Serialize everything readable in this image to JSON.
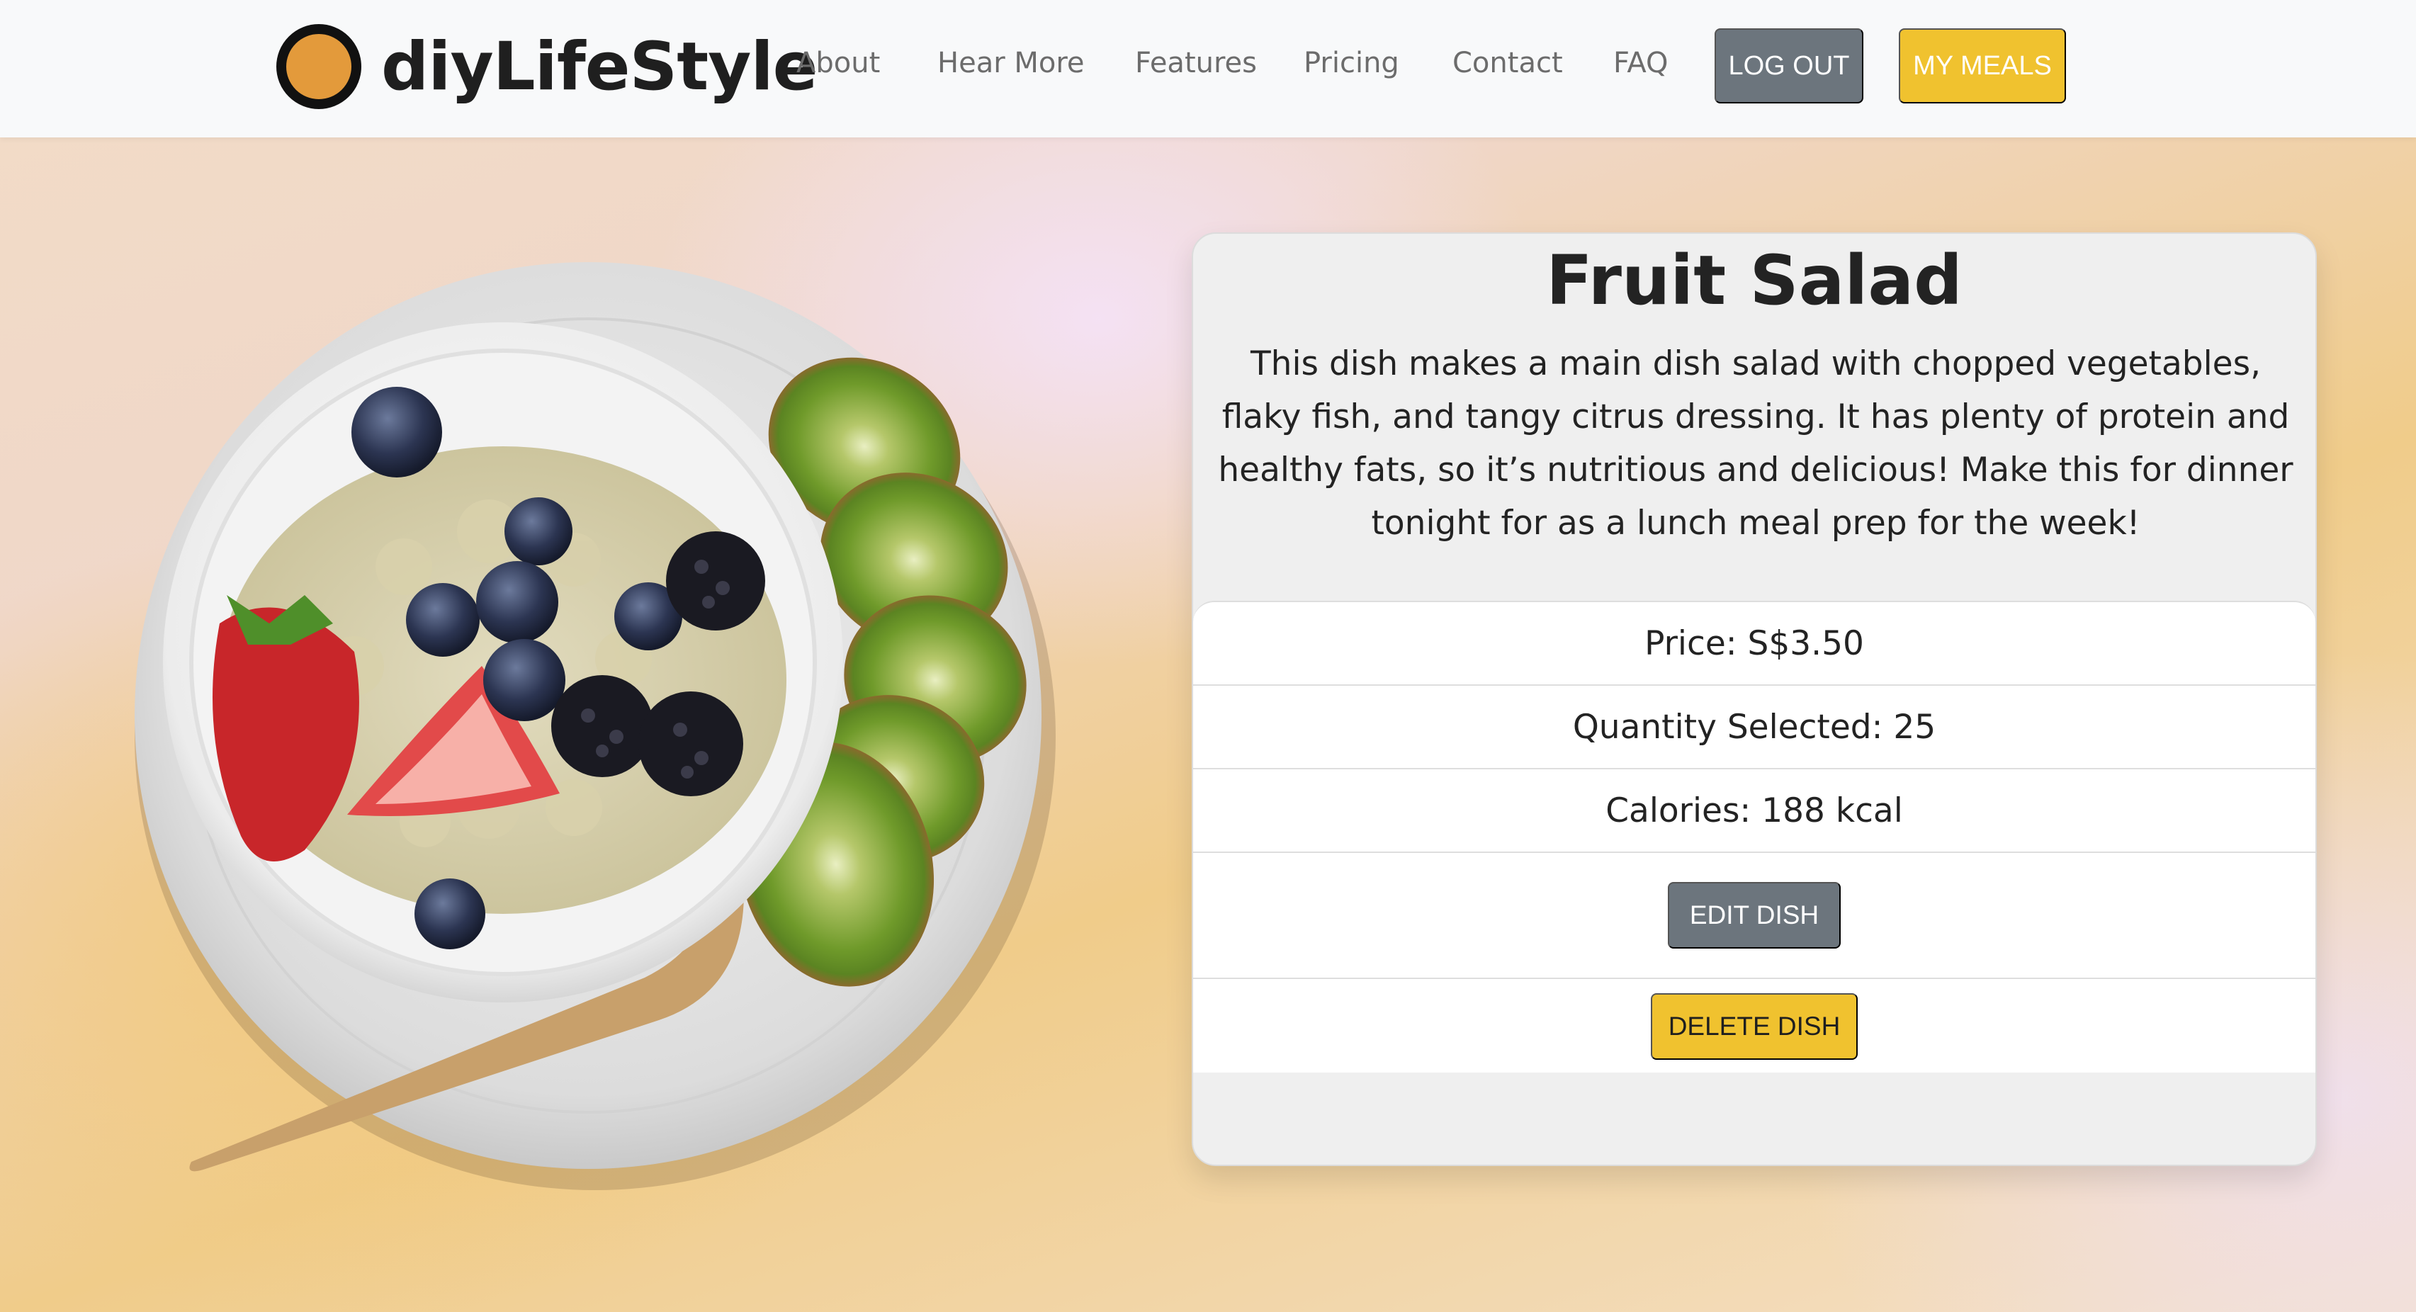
{
  "brand": {
    "name": "diyLifeStyle"
  },
  "nav": {
    "links": [
      "About",
      "Hear More",
      "Features",
      "Pricing",
      "Contact",
      "FAQ"
    ],
    "logout_label": "LOG OUT",
    "my_meals_label": "MY MEALS"
  },
  "dish": {
    "title": "Fruit Salad",
    "description": "This dish makes a main dish salad with chopped vegetables, flaky fish, and tangy citrus dressing. It has plenty of protein and healthy fats, so it’s nutritious and delicious! Make this for dinner tonight for as a lunch meal prep for the week!",
    "price": "Price: S$3.50",
    "quantity": "Quantity Selected: 25",
    "calories": "Calories: 188 kcal",
    "edit_label": "EDIT DISH",
    "delete_label": "DELETE DISH"
  },
  "colors": {
    "accent_yellow": "#f0c22f",
    "secondary_gray": "#6c757d",
    "logo_orange": "#e39a3b"
  }
}
